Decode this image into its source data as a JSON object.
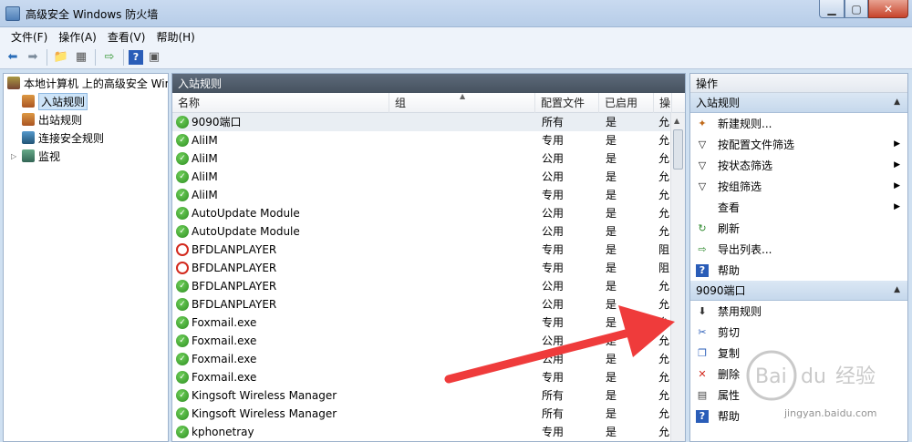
{
  "window": {
    "title": "高级安全 Windows 防火墙"
  },
  "menubar": {
    "items": [
      "文件(F)",
      "操作(A)",
      "查看(V)",
      "帮助(H)"
    ]
  },
  "tree": {
    "root": "本地计算机 上的高级安全 Windows",
    "items": [
      "入站规则",
      "出站规则",
      "连接安全规则",
      "监视"
    ]
  },
  "center": {
    "header": "入站规则",
    "columns": [
      "名称",
      "组",
      "配置文件",
      "已启用",
      "操"
    ],
    "rows": [
      {
        "name": "9090端口",
        "profile": "所有",
        "enabled": "是",
        "action": "允",
        "status": "allow"
      },
      {
        "name": "AliIM",
        "profile": "专用",
        "enabled": "是",
        "action": "允",
        "status": "allow"
      },
      {
        "name": "AliIM",
        "profile": "公用",
        "enabled": "是",
        "action": "允",
        "status": "allow"
      },
      {
        "name": "AliIM",
        "profile": "公用",
        "enabled": "是",
        "action": "允",
        "status": "allow"
      },
      {
        "name": "AliIM",
        "profile": "专用",
        "enabled": "是",
        "action": "允",
        "status": "allow"
      },
      {
        "name": "AutoUpdate Module",
        "profile": "公用",
        "enabled": "是",
        "action": "允",
        "status": "allow"
      },
      {
        "name": "AutoUpdate Module",
        "profile": "公用",
        "enabled": "是",
        "action": "允",
        "status": "allow"
      },
      {
        "name": "BFDLANPLAYER",
        "profile": "专用",
        "enabled": "是",
        "action": "阻",
        "status": "block"
      },
      {
        "name": "BFDLANPLAYER",
        "profile": "专用",
        "enabled": "是",
        "action": "阻",
        "status": "block"
      },
      {
        "name": "BFDLANPLAYER",
        "profile": "公用",
        "enabled": "是",
        "action": "允",
        "status": "allow"
      },
      {
        "name": "BFDLANPLAYER",
        "profile": "公用",
        "enabled": "是",
        "action": "允",
        "status": "allow"
      },
      {
        "name": "Foxmail.exe",
        "profile": "专用",
        "enabled": "是",
        "action": "允",
        "status": "allow"
      },
      {
        "name": "Foxmail.exe",
        "profile": "公用",
        "enabled": "是",
        "action": "允",
        "status": "allow"
      },
      {
        "name": "Foxmail.exe",
        "profile": "公用",
        "enabled": "是",
        "action": "允",
        "status": "allow"
      },
      {
        "name": "Foxmail.exe",
        "profile": "专用",
        "enabled": "是",
        "action": "允",
        "status": "allow"
      },
      {
        "name": "Kingsoft Wireless Manager",
        "profile": "所有",
        "enabled": "是",
        "action": "允",
        "status": "allow"
      },
      {
        "name": "Kingsoft Wireless Manager",
        "profile": "所有",
        "enabled": "是",
        "action": "允",
        "status": "allow"
      },
      {
        "name": "kphonetray",
        "profile": "专用",
        "enabled": "是",
        "action": "允",
        "status": "allow"
      }
    ]
  },
  "actions": {
    "title": "操作",
    "section1": "入站规则",
    "section1_items": [
      {
        "label": "新建规则...",
        "icon": "new-rule-icon",
        "submenu": false
      },
      {
        "label": "按配置文件筛选",
        "icon": "filter-icon",
        "submenu": true
      },
      {
        "label": "按状态筛选",
        "icon": "filter-icon",
        "submenu": true
      },
      {
        "label": "按组筛选",
        "icon": "filter-icon",
        "submenu": true
      },
      {
        "label": "查看",
        "icon": "",
        "submenu": true
      },
      {
        "label": "刷新",
        "icon": "refresh-icon",
        "submenu": false
      },
      {
        "label": "导出列表...",
        "icon": "export-icon",
        "submenu": false
      },
      {
        "label": "帮助",
        "icon": "help-icon",
        "submenu": false
      }
    ],
    "section2": "9090端口",
    "section2_items": [
      {
        "label": "禁用规则",
        "icon": "disable-icon"
      },
      {
        "label": "剪切",
        "icon": "cut-icon"
      },
      {
        "label": "复制",
        "icon": "copy-icon"
      },
      {
        "label": "删除",
        "icon": "delete-icon"
      },
      {
        "label": "属性",
        "icon": "properties-icon"
      },
      {
        "label": "帮助",
        "icon": "help-icon"
      }
    ]
  },
  "watermark": {
    "text": "jingyan.baidu.com"
  },
  "colors": {
    "arrow": "#ef3b3b",
    "allow": "#2e8f22",
    "block": "#d32a1e"
  }
}
